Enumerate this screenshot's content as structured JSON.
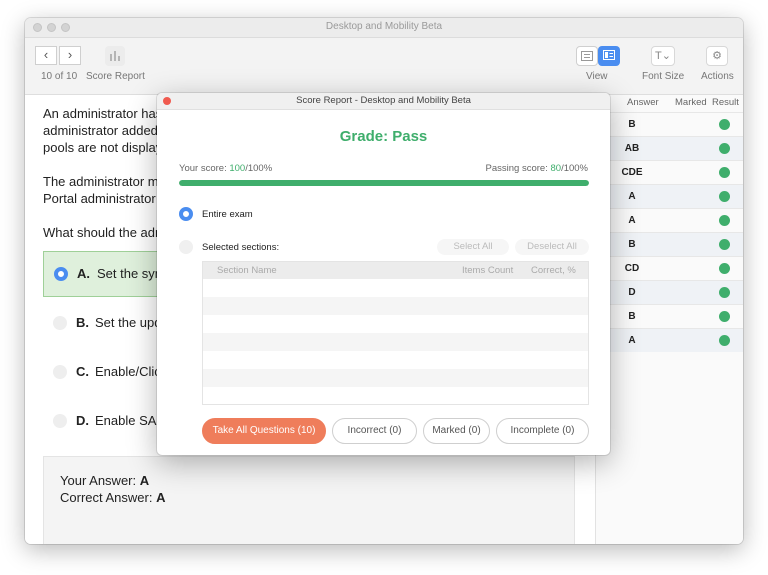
{
  "window": {
    "title": "Desktop and Mobility Beta"
  },
  "toolbar": {
    "back_glyph": "‹",
    "forward_glyph": "›",
    "position": "10 of 10",
    "score_report_label": "Score Report",
    "view_label": "View",
    "font_size_label": "Font Size",
    "actions_label": "Actions",
    "font_icon_glyph": "T⌄",
    "gear_glyph": "⚙",
    "accent_color": "#4a8df0"
  },
  "question": {
    "line1": "An administrator has",
    "line2": "administrator added",
    "line3": "pools are not display",
    "line4": "The administrator m",
    "line5": "Portal administrator",
    "line6": "What should the adm",
    "options": [
      {
        "letter": "A.",
        "text": "Set the syn"
      },
      {
        "letter": "B.",
        "text": "Set the upd"
      },
      {
        "letter": "C.",
        "text": "Enable/Clic"
      },
      {
        "letter": "D.",
        "text": "Enable SAM"
      }
    ],
    "your_answer_label": "Your Answer:",
    "your_answer": "A",
    "correct_answer_label": "Correct Answer:",
    "correct_answer": "A"
  },
  "results": {
    "headers": {
      "answer": "Answer",
      "marked": "Marked",
      "result": "Result"
    },
    "rows": [
      "B",
      "AB",
      "CDE",
      "A",
      "A",
      "B",
      "CD",
      "D",
      "B",
      "A"
    ],
    "result_color": "#3fae6c"
  },
  "modal": {
    "title": "Score Report - Desktop and Mobility Beta",
    "grade": "Grade: Pass",
    "your_score_label": "Your score:",
    "your_score_value": "100",
    "your_score_suffix": "/100%",
    "passing_label": "Passing score:",
    "passing_value": "80",
    "passing_suffix": "/100%",
    "progress": 1.0,
    "entire_exam": "Entire exam",
    "selected_sections": "Selected sections:",
    "select_all": "Select All",
    "deselect_all": "Deselect All",
    "col_section": "Section Name",
    "col_items": "Items Count",
    "col_correct": "Correct, %",
    "btn_take_all": "Take All Questions (10)",
    "btn_incorrect": "Incorrect (0)",
    "btn_marked": "Marked (0)",
    "btn_incomplete": "Incomplete (0)",
    "primary_color": "#ef7d5b",
    "pass_color": "#3fae6c"
  }
}
